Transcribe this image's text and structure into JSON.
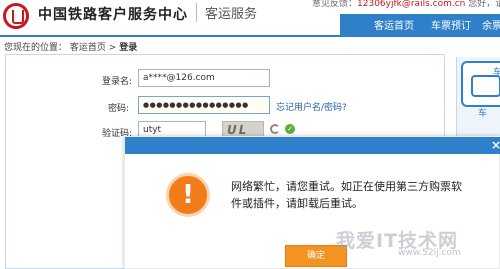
{
  "header": {
    "site_title": "中国铁路客户服务中心",
    "sub_title": "客运服务",
    "top_links_prefix": "意见反馈：",
    "top_links_email": "12306yjfk@rails.com.cn",
    "top_links_mid": " 您好，请",
    "top_links_login": "登录"
  },
  "nav": {
    "home": "客运首页",
    "tickets": "车票预订",
    "more": "余票"
  },
  "breadcrumb": {
    "prefix": "您现在的位置：",
    "home": "客运首页",
    "sep": ">",
    "current": "登录"
  },
  "login": {
    "username_label": "登录名:",
    "username_value": "a****@126.com",
    "password_label": "密码:",
    "password_value": "●●●●●●●●●●●●●●●●",
    "forgot": "忘记用户名/密码?",
    "captcha_label": "验证码:",
    "captcha_value": "utyt",
    "captcha_image_text": "UL"
  },
  "side": {
    "label": "车站",
    "label2": "车"
  },
  "dialog": {
    "close": "×",
    "message": "网络繁忙，请您重试。如正在使用第三方购票软件或插件，请卸载后重试。",
    "confirm": "确定"
  },
  "watermark": {
    "main": "我爱IT技术网",
    "sub": "www.52ij.com"
  },
  "colors": {
    "accent": "#2f80c9",
    "brand_red": "#c8161e",
    "warn_orange": "#f07c1a",
    "button_orange": "#f39321"
  }
}
